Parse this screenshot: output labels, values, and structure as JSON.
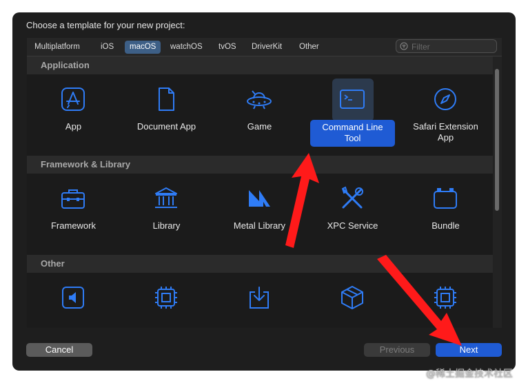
{
  "dialog": {
    "title": "Choose a template for your new project:"
  },
  "tabs": [
    {
      "label": "Multiplatform"
    },
    {
      "label": "iOS"
    },
    {
      "label": "macOS"
    },
    {
      "label": "watchOS"
    },
    {
      "label": "tvOS"
    },
    {
      "label": "DriverKit"
    },
    {
      "label": "Other"
    }
  ],
  "selected_tab": "macOS",
  "filter": {
    "placeholder": "Filter",
    "value": ""
  },
  "sections": [
    {
      "title": "Application",
      "items": [
        {
          "label": "App",
          "icon": "app-store-icon"
        },
        {
          "label": "Document App",
          "icon": "document-icon"
        },
        {
          "label": "Game",
          "icon": "game-ufo-icon"
        },
        {
          "label": "Command Line\nTool",
          "icon": "terminal-icon"
        },
        {
          "label": "Safari Extension\nApp",
          "icon": "compass-icon"
        }
      ]
    },
    {
      "title": "Framework & Library",
      "items": [
        {
          "label": "Framework",
          "icon": "toolbox-icon"
        },
        {
          "label": "Library",
          "icon": "library-icon"
        },
        {
          "label": "Metal Library",
          "icon": "metal-icon"
        },
        {
          "label": "XPC Service",
          "icon": "tools-icon"
        },
        {
          "label": "Bundle",
          "icon": "bundle-icon"
        }
      ]
    },
    {
      "title": "Other",
      "items": [
        {
          "label": "",
          "icon": "speaker-icon"
        },
        {
          "label": "",
          "icon": "chip-icon"
        },
        {
          "label": "",
          "icon": "download-tray-icon"
        },
        {
          "label": "",
          "icon": "package-icon"
        },
        {
          "label": "",
          "icon": "chip-icon"
        }
      ]
    }
  ],
  "selected_item": "Command Line\nTool",
  "buttons": {
    "cancel": "Cancel",
    "previous": "Previous",
    "next": "Next"
  },
  "watermark": "@稀土掘金技术社区",
  "colors": {
    "accent": "#1f5bd4",
    "icon_blue": "#2f7cf6",
    "annotation_arrow": "#ff1a1a",
    "window_bg": "#1e1e1e"
  }
}
